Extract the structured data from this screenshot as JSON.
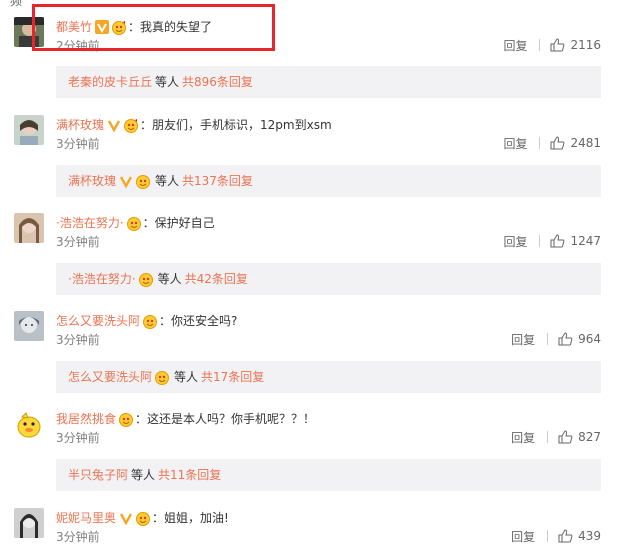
{
  "top_cut_text": "频",
  "comments": [
    {
      "username": "都美竹",
      "has_v_badge": true,
      "has_emoji": true,
      "text": "：我真的失望了",
      "time": "2分钟前",
      "reply_label": "回复",
      "likes": "2116",
      "thread": {
        "user": "老秦的皮卡丘丘",
        "user_badges": false,
        "mid": "等人",
        "total": "共896条回复"
      }
    },
    {
      "username": "满杯玫瑰",
      "has_v_badge": true,
      "has_emoji": true,
      "text": "：朋友们，手机标识，12pm到xsm",
      "time": "3分钟前",
      "reply_label": "回复",
      "likes": "2481",
      "thread": {
        "user": "满杯玫瑰",
        "user_badges": true,
        "mid": "等人",
        "total": "共137条回复"
      }
    },
    {
      "username": "·浩浩在努力·",
      "has_v_badge": false,
      "has_emoji": true,
      "text": "：保护好自己",
      "time": "3分钟前",
      "reply_label": "回复",
      "likes": "1247",
      "thread": {
        "user": "·浩浩在努力·",
        "user_badges": "emoji",
        "mid": "等人",
        "total": "共42条回复"
      }
    },
    {
      "username": "怎么又要洗头阿",
      "has_v_badge": false,
      "has_emoji": true,
      "text": "：你还安全吗?",
      "time": "3分钟前",
      "reply_label": "回复",
      "likes": "964",
      "thread": {
        "user": "怎么又要洗头阿",
        "user_badges": "emoji",
        "mid": "等人",
        "total": "共17条回复"
      }
    },
    {
      "username": "我居然挑食",
      "has_v_badge": false,
      "has_emoji": true,
      "text": "：这还是本人吗？你手机呢？？！",
      "time": "3分钟前",
      "reply_label": "回复",
      "likes": "827",
      "thread": {
        "user": "半只兔子阿",
        "user_badges": false,
        "mid": "等人",
        "total": "共11条回复"
      }
    },
    {
      "username": "妮妮马里奥",
      "has_v_badge": true,
      "has_emoji": true,
      "text": "：姐姐，加油!",
      "time": "3分钟前",
      "reply_label": "回复",
      "likes": "439",
      "thread": null
    }
  ],
  "colors": {
    "username": "#eb7350",
    "highlight_box": "#e8242c",
    "thread_bg": "#f2f2f5"
  }
}
